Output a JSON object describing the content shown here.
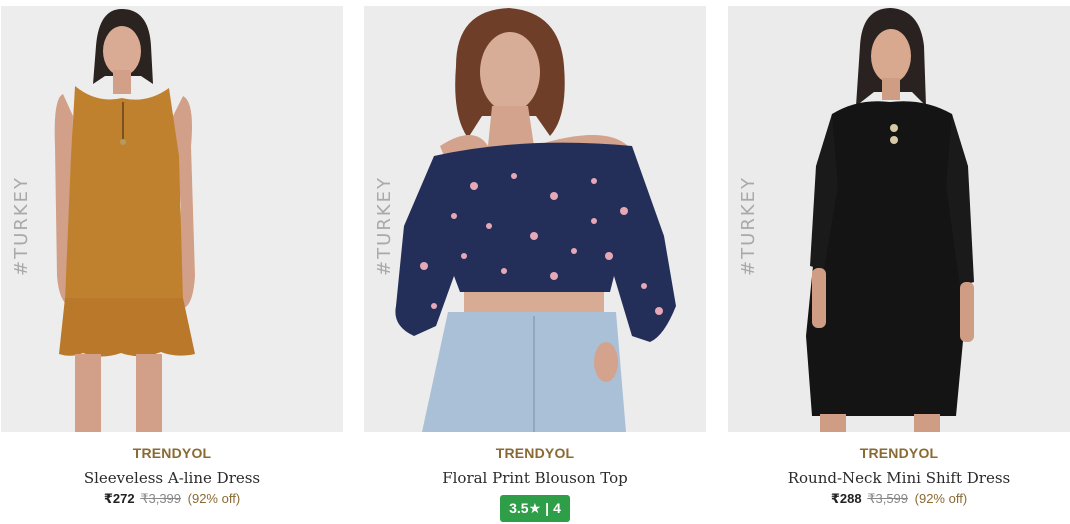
{
  "products": [
    {
      "watermark": "#TURKEY",
      "brand": "TRENDYOL",
      "name": "Sleeveless A-line Dress",
      "price": "₹272",
      "mrp": "₹3,399",
      "discount": "(92% off)",
      "image": "model in mustard sleeveless A-line dress with ruffle hem"
    },
    {
      "watermark": "#TURKEY",
      "brand": "TRENDYOL",
      "name": "Floral Print Blouson Top",
      "rating": "3.5★",
      "rating_count": "4",
      "rating_color": "#2e9e48",
      "image": "model in navy floral off-shoulder blouson top and denim"
    },
    {
      "watermark": "#TURKEY",
      "brand": "TRENDYOL",
      "name": "Round-Neck Mini Shift Dress",
      "price": "₹288",
      "mrp": "₹3,599",
      "discount": "(92% off)",
      "image": "model in black round-neck mini shift dress"
    }
  ],
  "colors": {
    "brand": "#8a6a33",
    "rating_badge": "#2e9e48"
  }
}
